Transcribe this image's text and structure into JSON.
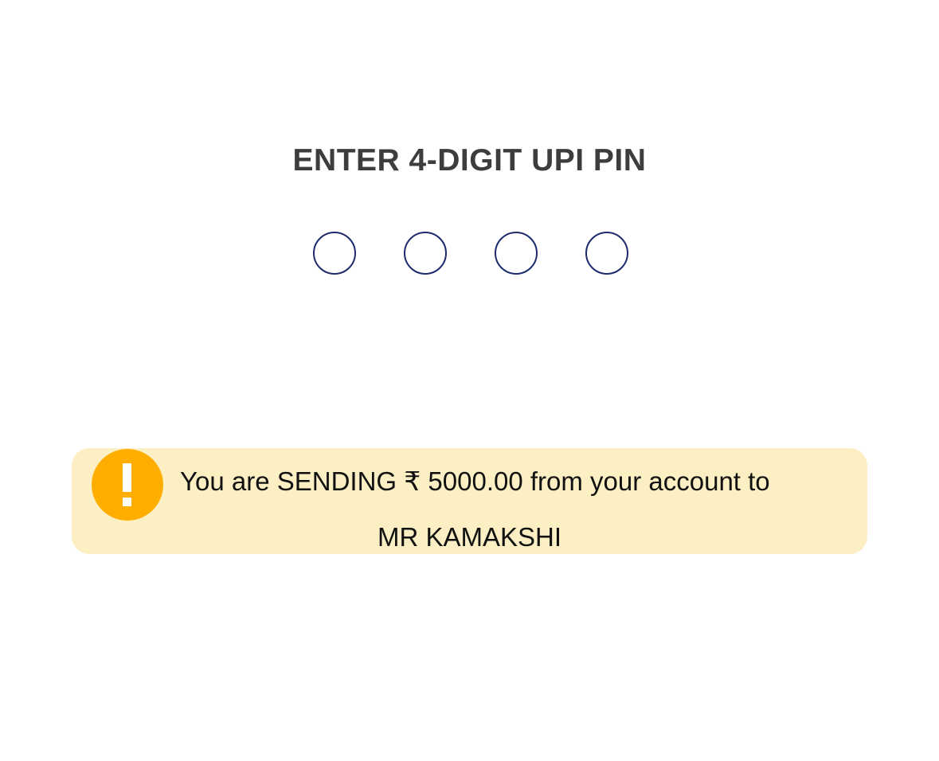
{
  "pin_prompt": {
    "title": "ENTER 4-DIGIT UPI PIN",
    "digits_entered": 0,
    "digits_total": 4
  },
  "warning": {
    "icon": "exclamation-icon",
    "line1": "You are SENDING ₹ 5000.00 from your account to",
    "line2": "MR KAMAKSHI",
    "icon_color": "#FFAE00",
    "background_color": "#FCEFC4"
  },
  "colors": {
    "pin_dot_border": "#1D2A6B",
    "title_text": "#3D3D3D"
  }
}
